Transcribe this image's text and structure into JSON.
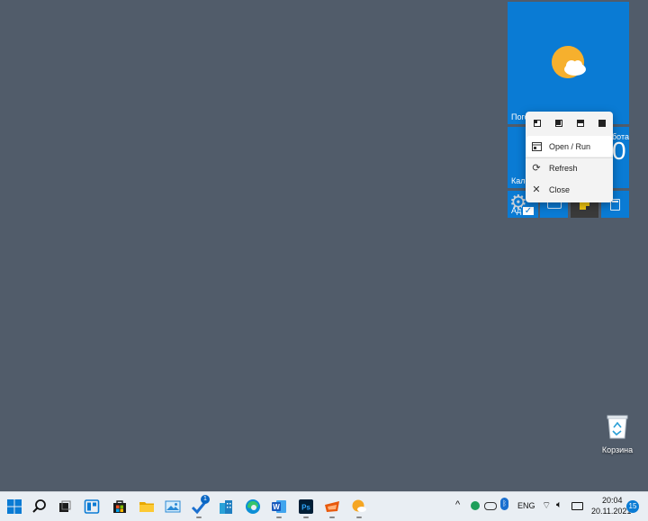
{
  "tiles": {
    "weather": {
      "label": "Пого"
    },
    "date": {
      "left_label": "Кале",
      "right_label": "бота",
      "big_digit": "0"
    },
    "settings": {
      "label": "Ад"
    }
  },
  "context_menu": {
    "sizes": [
      "small-tile",
      "medium-tile",
      "wide-tile",
      "large-tile"
    ],
    "items": [
      {
        "label": "Open / Run",
        "icon": "open-run-icon"
      },
      {
        "label": "Refresh",
        "icon": "refresh-icon"
      },
      {
        "label": "Close",
        "icon": "close-icon"
      }
    ]
  },
  "desktop": {
    "recycle_bin_label": "Корзина"
  },
  "taskbar": {
    "todo_badge": "1",
    "language": "ENG",
    "time": "20:04",
    "date": "20.11.2021",
    "notification_count": "15"
  },
  "colors": {
    "desktop": "#515c6a",
    "tile_blue": "#0a7bd4",
    "taskbar": "#e9eef3",
    "accent": "#0a7bd4"
  }
}
